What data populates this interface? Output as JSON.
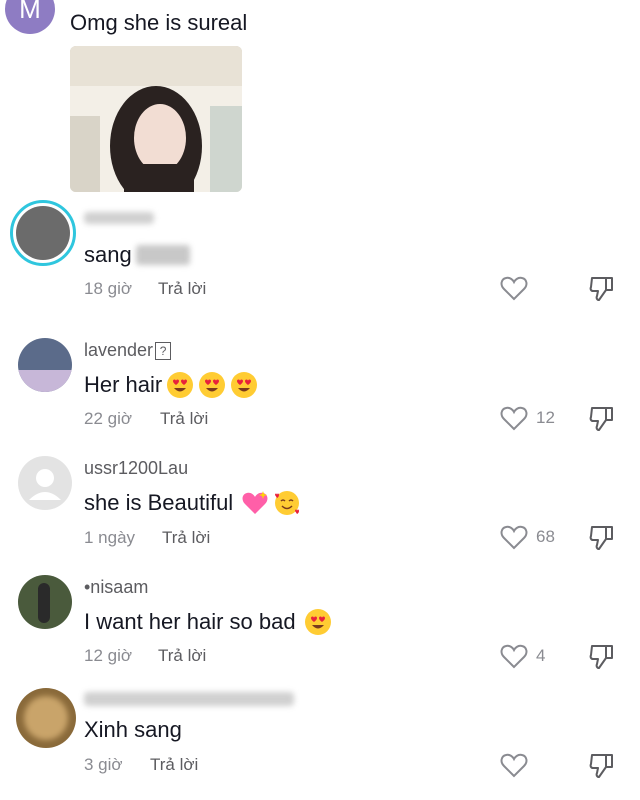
{
  "top_comment": {
    "avatar_letter": "M",
    "avatar_color": "#8e7cc3",
    "text": "Omg she is sureal"
  },
  "comments": [
    {
      "username": "",
      "text": "sang",
      "time": "18 giờ",
      "reply_label": "Trả lời",
      "likes": ""
    },
    {
      "username": "lavender",
      "text": "Her hair",
      "time": "22 giờ",
      "reply_label": "Trả lời",
      "likes": "12",
      "emojis": [
        "heart-eyes-emoji",
        "heart-eyes-emoji",
        "heart-eyes-emoji"
      ]
    },
    {
      "username": "ussr1200Lau",
      "text": "she is Beautiful",
      "time": "1 ngày",
      "reply_label": "Trả lời",
      "likes": "68",
      "emojis": [
        "sparkling-heart-emoji",
        "smiling-hearts-emoji"
      ]
    },
    {
      "username": "•nisaam",
      "text": "I want her hair so bad",
      "time": "12 giờ",
      "reply_label": "Trả lời",
      "likes": "4",
      "emojis": [
        "heart-eyes-emoji"
      ]
    },
    {
      "username": "",
      "text": "Xinh sang",
      "time": "3 giờ",
      "reply_label": "Trả lời",
      "likes": ""
    }
  ]
}
